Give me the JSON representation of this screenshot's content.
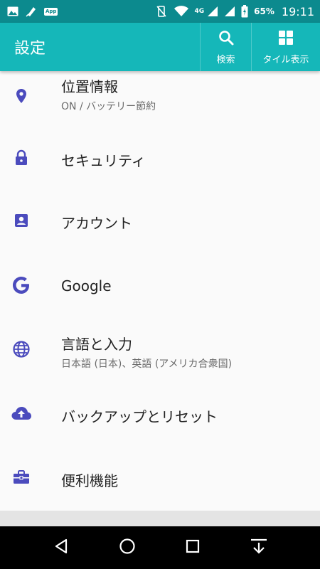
{
  "status_bar": {
    "network": "4G",
    "battery": "65%",
    "time": "19:11",
    "app_badge": "App"
  },
  "app_bar": {
    "title": "設定",
    "actions": [
      {
        "label": "検索",
        "icon": "search-icon"
      },
      {
        "label": "タイル表示",
        "icon": "tile-view-icon"
      }
    ]
  },
  "settings": [
    {
      "title": "位置情報",
      "subtitle": "ON / バッテリー節約",
      "icon": "location-pin-icon"
    },
    {
      "title": "セキュリティ",
      "icon": "lock-icon"
    },
    {
      "title": "アカウント",
      "icon": "account-icon"
    },
    {
      "title": "Google",
      "icon": "google-icon"
    },
    {
      "title": "言語と入力",
      "subtitle": "日本語 (日本)、英語 (アメリカ合衆国)",
      "icon": "globe-icon"
    },
    {
      "title": "バックアップとリセット",
      "icon": "cloud-upload-icon"
    },
    {
      "title": "便利機能",
      "icon": "toolbox-icon"
    }
  ],
  "colors": {
    "status_bar": "#0c8a8e",
    "app_bar": "#15b7b9",
    "icon_accent": "#4b4bbd",
    "background": "#fafafa"
  }
}
